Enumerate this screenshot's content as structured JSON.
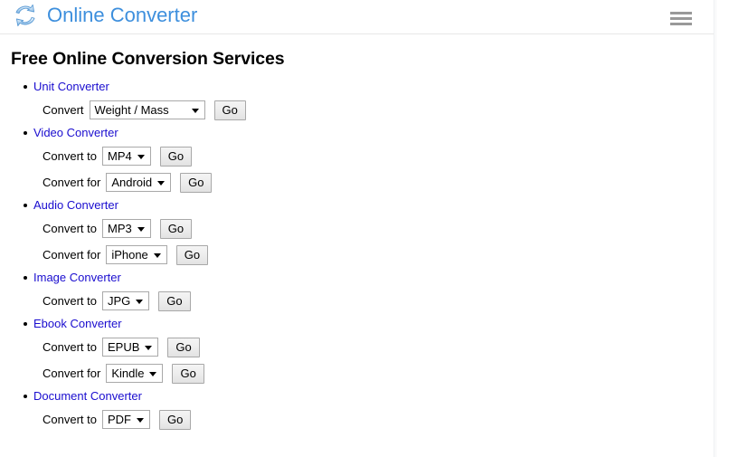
{
  "header": {
    "logo_icon": "circular-arrows-refresh-icon",
    "brand_title": "Online Converter",
    "brand_color": "#3d8fdd",
    "menu_icon": "hamburger-menu-icon"
  },
  "main": {
    "page_title": "Free Online Conversion Services",
    "link_color": "#1a0dcf",
    "services": [
      {
        "name": "Unit Converter",
        "rows": [
          {
            "label": "Convert",
            "value": "Weight / Mass",
            "button": "Go",
            "wide": true
          }
        ]
      },
      {
        "name": "Video Converter",
        "rows": [
          {
            "label": "Convert to",
            "value": "MP4",
            "button": "Go",
            "wide": false
          },
          {
            "label": "Convert for",
            "value": "Android",
            "button": "Go",
            "wide": false
          }
        ]
      },
      {
        "name": "Audio Converter",
        "rows": [
          {
            "label": "Convert to",
            "value": "MP3",
            "button": "Go",
            "wide": false
          },
          {
            "label": "Convert for",
            "value": "iPhone",
            "button": "Go",
            "wide": false
          }
        ]
      },
      {
        "name": "Image Converter",
        "rows": [
          {
            "label": "Convert to",
            "value": "JPG",
            "button": "Go",
            "wide": false
          }
        ]
      },
      {
        "name": "Ebook Converter",
        "rows": [
          {
            "label": "Convert to",
            "value": "EPUB",
            "button": "Go",
            "wide": false
          },
          {
            "label": "Convert for",
            "value": "Kindle",
            "button": "Go",
            "wide": false
          }
        ]
      },
      {
        "name": "Document Converter",
        "rows": [
          {
            "label": "Convert to",
            "value": "PDF",
            "button": "Go",
            "wide": false
          }
        ]
      }
    ]
  }
}
